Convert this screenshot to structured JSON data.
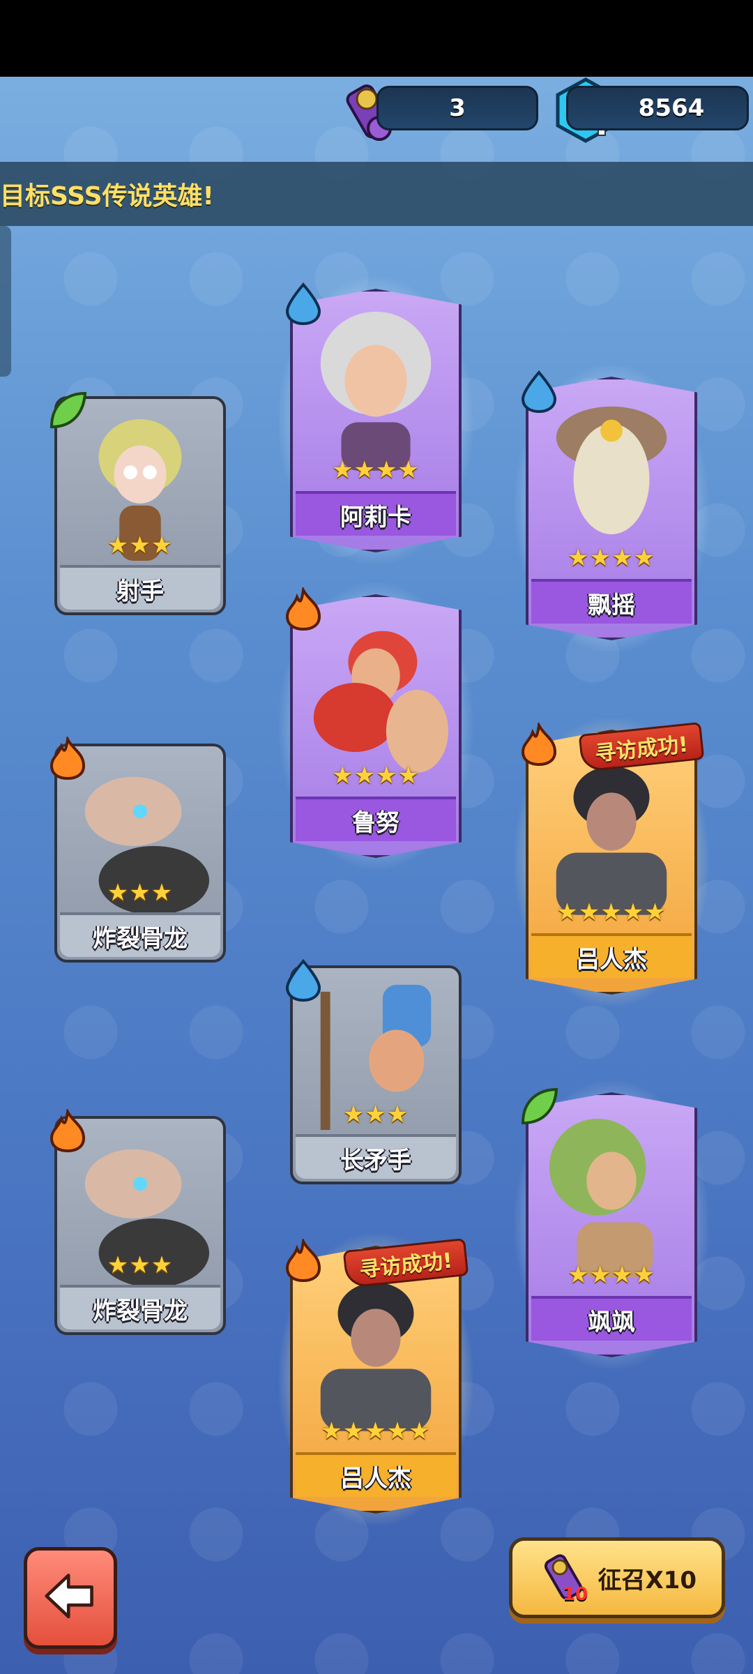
{
  "currency": {
    "scroll_count": "3",
    "gem_count": "8564"
  },
  "banner_text": "目标SSS传说英雄!",
  "cards": {
    "shooter": {
      "name": "射手",
      "stars": "★★★",
      "element": "leaf"
    },
    "alika": {
      "name": "阿莉卡",
      "stars": "★★★★",
      "element": "water"
    },
    "piaoyao": {
      "name": "飘摇",
      "stars": "★★★★",
      "element": "water"
    },
    "lunu": {
      "name": "鲁努",
      "stars": "★★★★",
      "element": "fire"
    },
    "bonedragon1": {
      "name": "炸裂骨龙",
      "stars": "★★★",
      "element": "fire"
    },
    "lurenjie1": {
      "name": "吕人杰",
      "stars": "★★★★★",
      "element": "fire",
      "tag": "寻访成功!"
    },
    "spearman": {
      "name": "长矛手",
      "stars": "★★★",
      "element": "water"
    },
    "bonedragon2": {
      "name": "炸裂骨龙",
      "stars": "★★★",
      "element": "fire"
    },
    "sasa": {
      "name": "飒飒",
      "stars": "★★★★",
      "element": "leaf"
    },
    "lurenjie2": {
      "name": "吕人杰",
      "stars": "★★★★★",
      "element": "fire",
      "tag": "寻访成功!"
    }
  },
  "buttons": {
    "summon_label": "征召X10",
    "summon_badge": "10"
  },
  "colors": {
    "rarity_gray": "#b9c2cf",
    "rarity_purple": "#9a57e0",
    "rarity_gold": "#f6b02c"
  }
}
